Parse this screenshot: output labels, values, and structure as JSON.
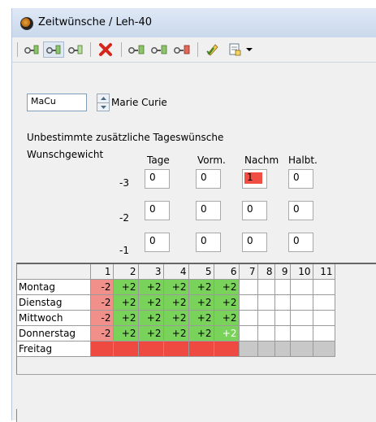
{
  "window": {
    "title": "Zeitwünsche / Leh-40"
  },
  "toolbar": {
    "buttons": [
      {
        "icon": "teacher-key-icon"
      },
      {
        "icon": "teacher-key-active-icon"
      },
      {
        "icon": "teacher-key-alt-icon"
      },
      {
        "icon": "delete-x-icon"
      },
      {
        "icon": "key-1-icon"
      },
      {
        "icon": "key-2-icon"
      },
      {
        "icon": "key-3-icon"
      },
      {
        "icon": "pen-check-icon"
      },
      {
        "icon": "print-preview-icon"
      },
      {
        "icon": "dropdown-arrow-icon"
      }
    ]
  },
  "teacher": {
    "code": "MaCu",
    "name": "Marie Curie"
  },
  "wishes": {
    "section_title": "Unbestimmte zusätzliche Tageswünsche",
    "weight_label": "Wunschgewicht",
    "columns": [
      "Tage",
      "Vorm.",
      "Nachm",
      "Halbt."
    ],
    "rows": [
      {
        "weight": "-3",
        "values": [
          "0",
          "0",
          "1",
          "0"
        ]
      },
      {
        "weight": "-2",
        "values": [
          "0",
          "0",
          "0",
          "0"
        ]
      },
      {
        "weight": "-1",
        "values": [
          "0",
          "0",
          "0",
          "0"
        ]
      }
    ],
    "highlight_color": "#f04e43"
  },
  "grid": {
    "periods": [
      "1",
      "2",
      "3",
      "4",
      "5",
      "6",
      "7",
      "8",
      "9",
      "10",
      "11"
    ],
    "days": [
      {
        "name": "Montag",
        "cells": [
          "-2",
          "+2",
          "+2",
          "+2",
          "+2",
          "+2",
          "",
          "",
          "",
          "",
          ""
        ]
      },
      {
        "name": "Dienstag",
        "cells": [
          "-2",
          "+2",
          "+2",
          "+2",
          "+2",
          "+2",
          "",
          "",
          "",
          "",
          ""
        ]
      },
      {
        "name": "Mittwoch",
        "cells": [
          "-2",
          "+2",
          "+2",
          "+2",
          "+2",
          "+2",
          "",
          "",
          "",
          "",
          ""
        ]
      },
      {
        "name": "Donnerstag",
        "cells": [
          "-2",
          "+2",
          "+2",
          "+2",
          "+2",
          "+2",
          "",
          "",
          "",
          "",
          ""
        ]
      },
      {
        "name": "Freitag",
        "cells": [
          "",
          "",
          "",
          "",
          "",
          "",
          "",
          "",
          "",
          "",
          ""
        ]
      }
    ],
    "colors": {
      "negative": "#f18f8a",
      "positive": "#79d35a",
      "blocked": "#ee4a42",
      "grey": "#c8c8c8",
      "empty": "#ffffff"
    }
  }
}
